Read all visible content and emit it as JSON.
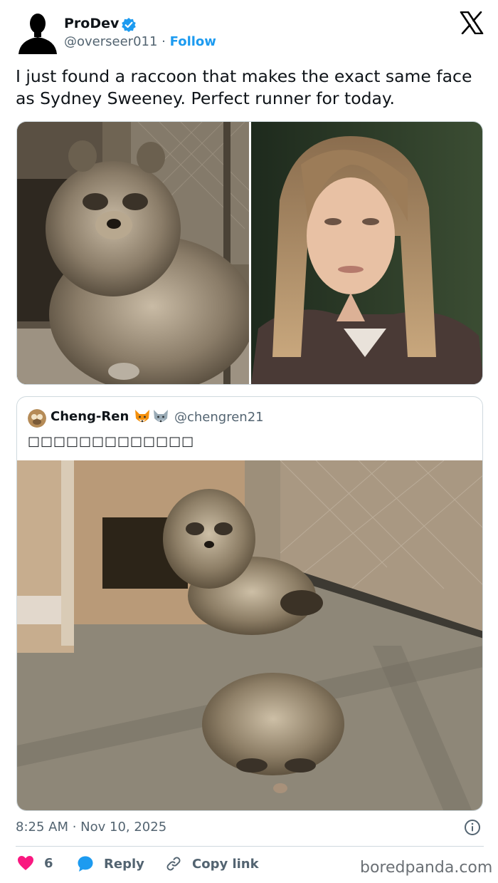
{
  "author": {
    "name": "ProDev",
    "handle": "@overseer011",
    "separator": "·",
    "follow_label": "Follow",
    "verified_color": "#1d9bf0"
  },
  "tweet": {
    "text": "I just found a raccoon that makes the exact same face as Sydney Sweeney. Perfect runner for today."
  },
  "quote": {
    "name": "Cheng-Ren",
    "name_emojis": [
      "fox-face",
      "wolf-face"
    ],
    "handle": "@chengren21",
    "text": "□□□□□□□□□□□□□"
  },
  "meta": {
    "timestamp": "8:25 AM · Nov 10, 2025"
  },
  "actions": {
    "like_count": "6",
    "like_color": "#f91880",
    "reply_label": "Reply",
    "reply_color": "#1d9bf0",
    "copy_label": "Copy link"
  },
  "watermark": "boredpanda.com",
  "icons": [
    "x-logo-icon",
    "verified-badge-icon",
    "info-icon",
    "heart-icon",
    "reply-bubble-icon",
    "link-icon"
  ]
}
